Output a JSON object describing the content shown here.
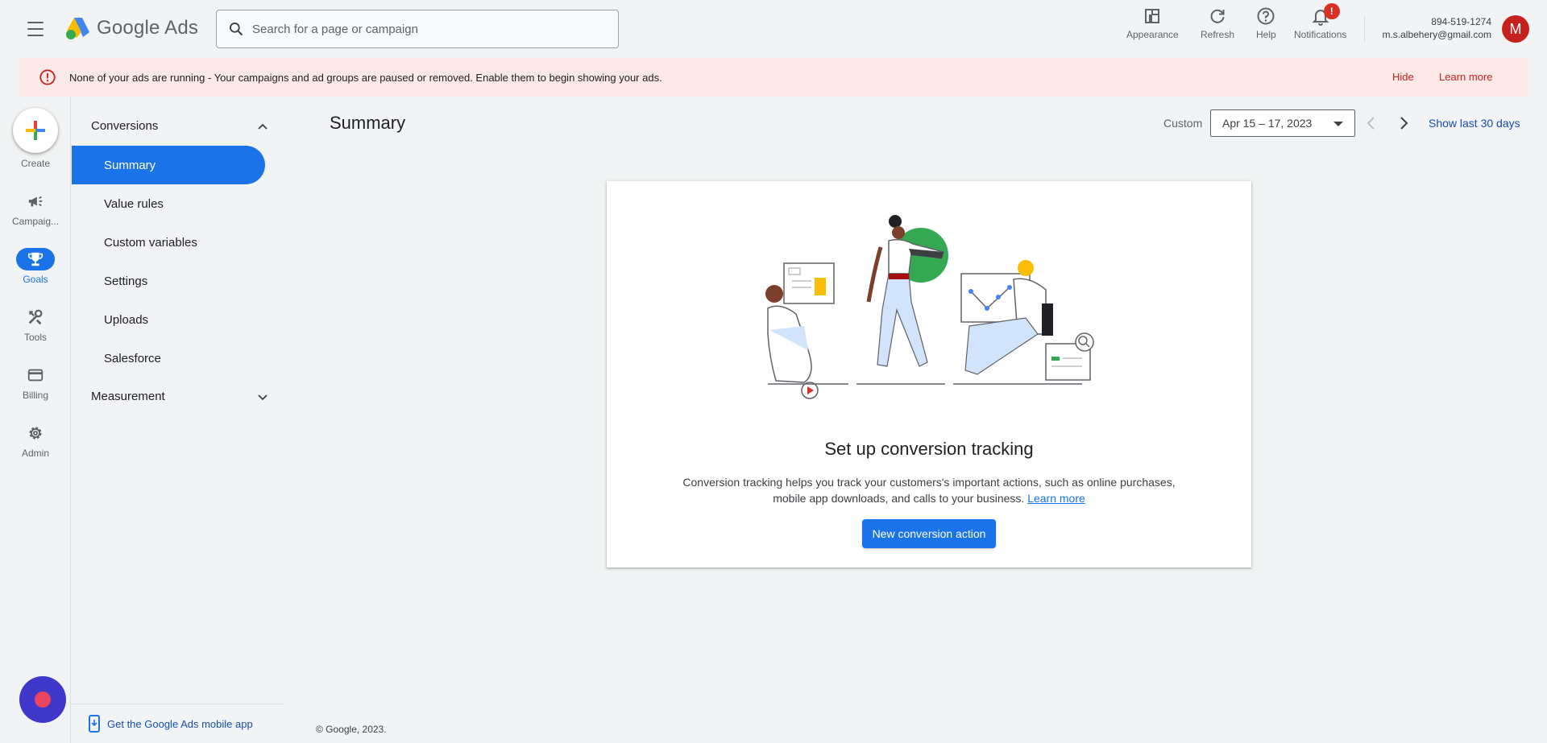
{
  "header": {
    "app_name": "Google Ads",
    "search_placeholder": "Search for a page or campaign",
    "actions": {
      "appearance": "Appearance",
      "refresh": "Refresh",
      "help": "Help",
      "notifications": "Notifications",
      "notifications_badge": "!"
    },
    "account": {
      "customer_id": "894-519-1274",
      "email": "m.s.albehery@gmail.com",
      "avatar_initial": "M"
    }
  },
  "banner": {
    "message": "None of your ads are running - Your campaigns and ad groups are paused or removed. Enable them to begin showing your ads.",
    "hide": "Hide",
    "learn_more": "Learn more",
    "accent_color": "#c5221f"
  },
  "rail": {
    "create": "Create",
    "campaigns": "Campaig...",
    "goals": "Goals",
    "tools": "Tools",
    "billing": "Billing",
    "admin": "Admin"
  },
  "subnav": {
    "section_conversions": "Conversions",
    "items": [
      "Summary",
      "Value rules",
      "Custom variables",
      "Settings",
      "Uploads",
      "Salesforce"
    ],
    "active_item": "Summary",
    "section_measurement": "Measurement",
    "mobile_app_link": "Get the Google Ads mobile app"
  },
  "main": {
    "title": "Summary",
    "date_range_label": "Custom",
    "date_range_value": "Apr 15 – 17, 2023",
    "show_last": "Show last 30 days",
    "card": {
      "title": "Set up conversion tracking",
      "description": "Conversion tracking helps you track your customers's important actions, such as online purchases, mobile app downloads, and calls to your business.",
      "learn_more": "Learn more",
      "button": "New conversion action"
    },
    "copyright": "© Google, 2023."
  },
  "colors": {
    "primary": "#1a73e8",
    "banner_bg": "#fce8e6",
    "background": "#f1f3f4"
  }
}
